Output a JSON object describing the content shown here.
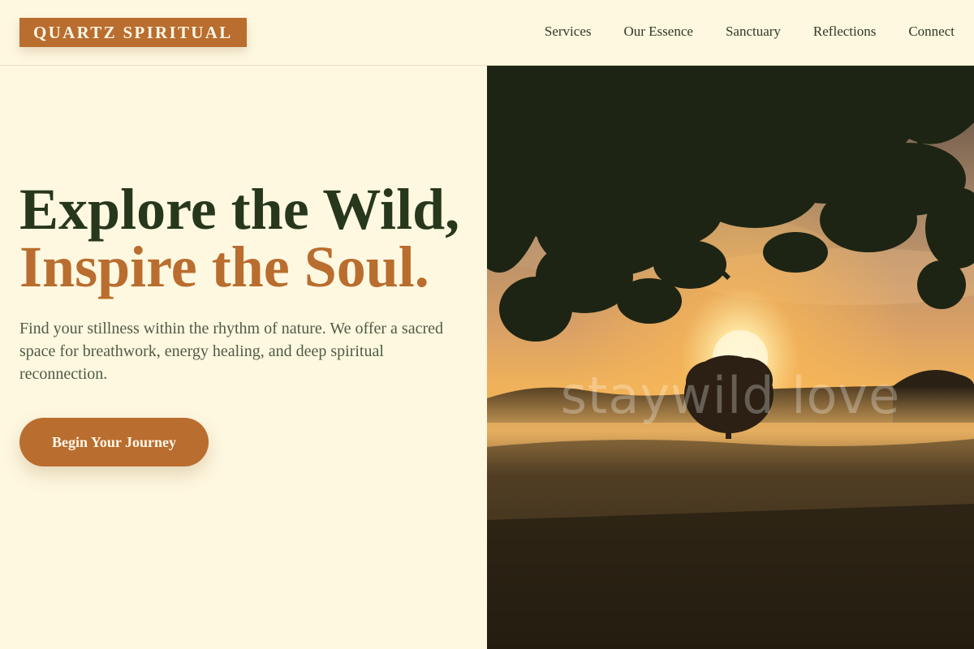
{
  "header": {
    "logo": "QUARTZ SPIRITUAL",
    "nav": [
      {
        "label": "Services"
      },
      {
        "label": "Our Essence"
      },
      {
        "label": "Sanctuary"
      },
      {
        "label": "Reflections"
      },
      {
        "label": "Connect"
      }
    ]
  },
  "hero": {
    "headline_line1": "Explore the Wild,",
    "headline_line2": "Inspire the Soul.",
    "description": "Find your stillness within the rhythm of nature. We offer a sacred space for breathwork, energy healing, and deep spiritual reconnection.",
    "cta_label": "Begin Your Journey"
  },
  "image": {
    "subject": "sunrise-meadow-tree-photo",
    "watermark": "staywild love"
  },
  "colors": {
    "background": "#fef8e0",
    "accent": "#b96d2e",
    "headline_dark": "#27371c",
    "body_text": "#4f5b46"
  }
}
